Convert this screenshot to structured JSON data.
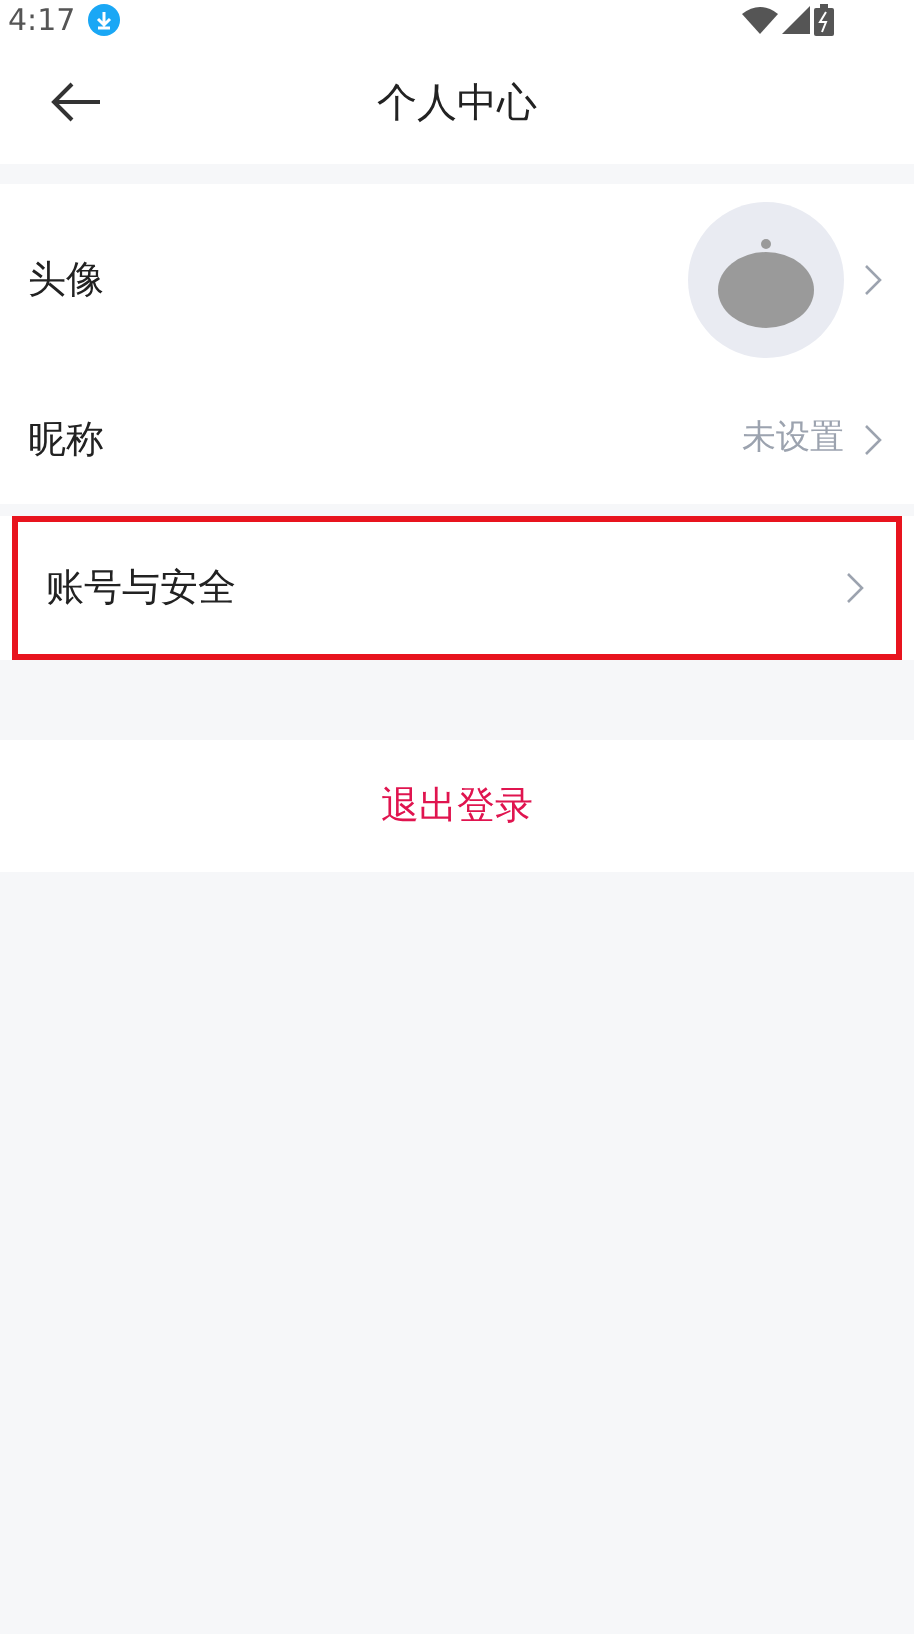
{
  "status_bar": {
    "time": "4:17"
  },
  "header": {
    "title": "个人中心"
  },
  "rows": [
    {
      "label": "头像",
      "highlighted": false
    },
    {
      "kind": "value",
      "label": "昵称",
      "value": "未设置",
      "highlighted": false
    },
    {
      "kind": "link",
      "label": "账号与安全",
      "highlighted": true
    }
  ],
  "logout_button": {
    "label": "退出登录"
  }
}
